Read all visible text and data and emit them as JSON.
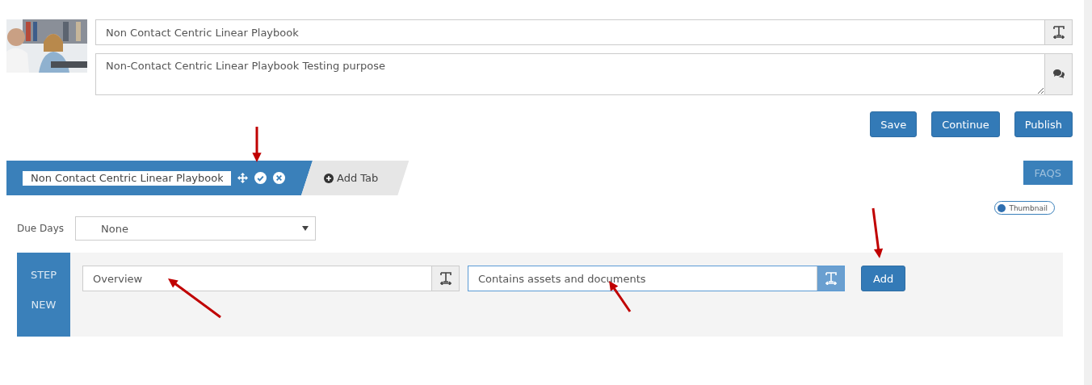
{
  "header": {
    "title": {
      "value": "Non Contact Centric Linear Playbook"
    },
    "description": {
      "value": "Non-Contact Centric Linear Playbook Testing purpose"
    }
  },
  "actions": [
    "Save",
    "Continue",
    "Publish"
  ],
  "tabs": [
    {
      "label": "Non Contact Centric Linear Playbook",
      "selected": true
    }
  ],
  "add_tab": "Add Tab",
  "faqs": "FAQS",
  "thumbnail_toggle": {
    "label": "Thumbnail",
    "on": false
  },
  "due_days": {
    "label": "Due Days",
    "value": "None"
  },
  "step": {
    "labels": [
      "STEP",
      "NEW"
    ],
    "name": {
      "value": "Overview",
      "focused": false
    },
    "description": {
      "value": "Contains assets and documents",
      "focused": true
    },
    "add": "Add"
  }
}
